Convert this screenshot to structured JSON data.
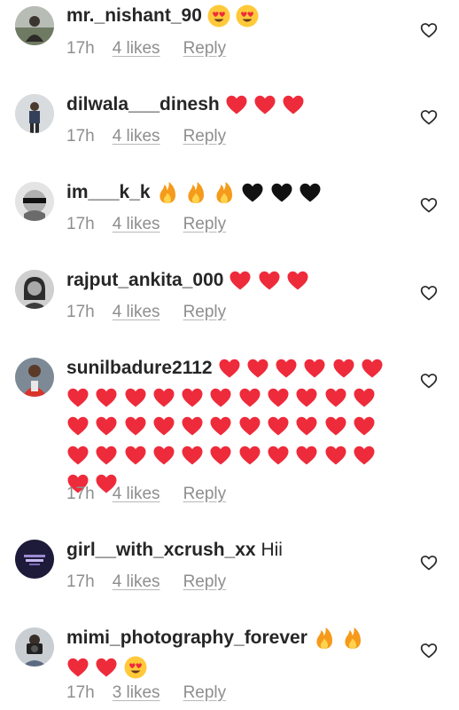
{
  "comments": [
    {
      "username": "mr._nishant_90",
      "text": "",
      "emojis": [
        "heart-eyes",
        "heart-eyes"
      ],
      "time": "17h",
      "likes": "4 likes",
      "reply": "Reply",
      "avatar": "avatar-photo-man-outdoors"
    },
    {
      "username": "dilwala___dinesh",
      "text": "",
      "emojis": [
        "red-heart",
        "red-heart",
        "red-heart"
      ],
      "time": "17h",
      "likes": "4 likes",
      "reply": "Reply",
      "avatar": "avatar-photo-man-standing"
    },
    {
      "username": "im___k_k",
      "text": "",
      "emojis": [
        "fire",
        "fire",
        "fire",
        "black-heart",
        "black-heart",
        "black-heart"
      ],
      "time": "17h",
      "likes": "4 likes",
      "reply": "Reply",
      "avatar": "avatar-photo-face-censored"
    },
    {
      "username": "rajput_ankita_000",
      "text": "",
      "emojis": [
        "red-heart",
        "red-heart",
        "red-heart"
      ],
      "time": "17h",
      "likes": "4 likes",
      "reply": "Reply",
      "avatar": "avatar-photo-woman"
    },
    {
      "username": "sunilbadure2112",
      "text": "",
      "emojis_first_line": 6,
      "emojis_per_row": 11,
      "emoji_total": 41,
      "emoji_kind": "red-heart",
      "time": "17h",
      "likes": "4 likes",
      "reply": "Reply",
      "avatar": "avatar-photo-man-red-shirt"
    },
    {
      "username": "girl__with_xcrush_xx",
      "text": "Hii",
      "emojis": [],
      "time": "17h",
      "likes": "4 likes",
      "reply": "Reply",
      "avatar": "avatar-dark-text-logo"
    },
    {
      "username": "mimi_photography_forever",
      "text": "",
      "emojis": [
        "fire",
        "fire"
      ],
      "emojis_second_line": [
        "red-heart",
        "red-heart",
        "heart-eyes"
      ],
      "time": "17h",
      "likes": "3 likes",
      "reply": "Reply",
      "avatar": "avatar-photo-camera-person"
    }
  ],
  "colors": {
    "username": "#262626",
    "meta": "#8e8e8e",
    "heart_red": "#ee2b3b",
    "heart_black": "#111111",
    "fire_orange": "#f59a1b",
    "emoji_yellow": "#ffc93a"
  },
  "icons": {
    "like": "heart-outline-icon"
  }
}
